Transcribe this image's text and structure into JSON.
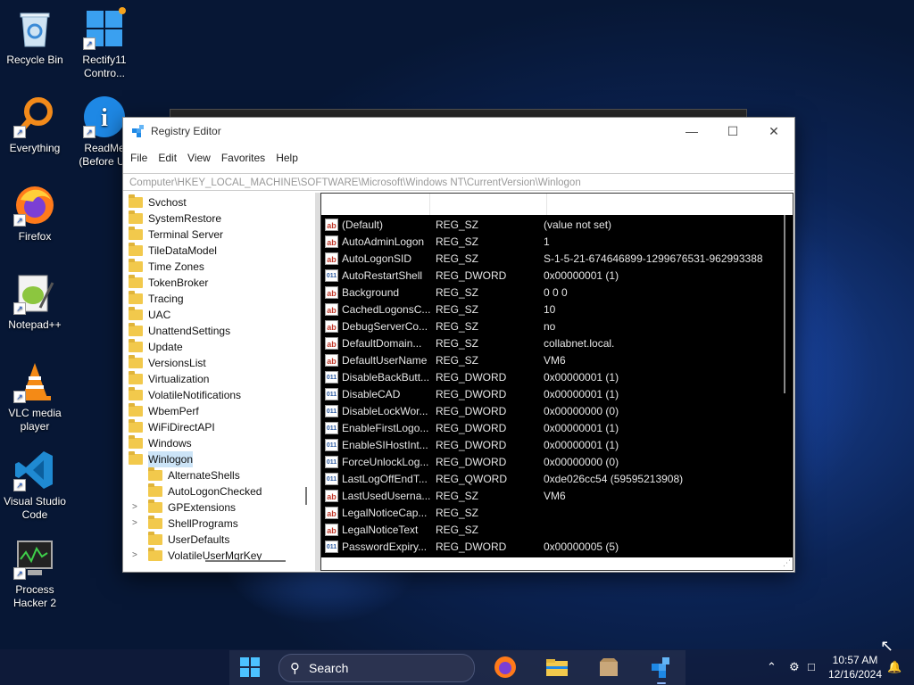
{
  "desktop": {
    "icons": [
      {
        "label": "Recycle Bin"
      },
      {
        "label": "Rectify11 Contro..."
      },
      {
        "label": "Everything"
      },
      {
        "label": "ReadMe (Before Us"
      },
      {
        "label": "Firefox"
      },
      {
        "label": "Notepad++"
      },
      {
        "label": "VLC media player"
      },
      {
        "label": "Visual Studio Code"
      },
      {
        "label": "Process Hacker 2"
      }
    ]
  },
  "window": {
    "title": "Registry Editor",
    "minimize": "—",
    "maximize": "☐",
    "close": "✕",
    "menu": [
      "File",
      "Edit",
      "View",
      "Favorites",
      "Help"
    ],
    "address": "Computer\\HKEY_LOCAL_MACHINE\\SOFTWARE\\Microsoft\\Windows NT\\CurrentVersion\\Winlogon"
  },
  "tree": {
    "items": [
      {
        "label": "Svchost"
      },
      {
        "label": "SystemRestore"
      },
      {
        "label": "Terminal Server"
      },
      {
        "label": "TileDataModel"
      },
      {
        "label": "Time Zones"
      },
      {
        "label": "TokenBroker"
      },
      {
        "label": "Tracing"
      },
      {
        "label": "UAC"
      },
      {
        "label": "UnattendSettings"
      },
      {
        "label": "Update"
      },
      {
        "label": "VersionsList"
      },
      {
        "label": "Virtualization"
      },
      {
        "label": "VolatileNotifications"
      },
      {
        "label": "WbemPerf"
      },
      {
        "label": "WiFiDirectAPI"
      },
      {
        "label": "Windows"
      },
      {
        "label": "Winlogon",
        "selected": true
      }
    ],
    "children": [
      {
        "label": "AlternateShells",
        "expander": ""
      },
      {
        "label": "AutoLogonChecked",
        "expander": ""
      },
      {
        "label": "GPExtensions",
        "expander": ">"
      },
      {
        "label": "ShellPrograms",
        "expander": ">"
      },
      {
        "label": "UserDefaults",
        "expander": ""
      },
      {
        "label": "VolatileUserMgrKey",
        "expander": ">"
      }
    ]
  },
  "values": {
    "rows": [
      {
        "name": "(Default)",
        "type": "REG_SZ",
        "data": "(value not set)",
        "icon": "ab"
      },
      {
        "name": "AutoAdminLogon",
        "type": "REG_SZ",
        "data": "1",
        "icon": "ab"
      },
      {
        "name": "AutoLogonSID",
        "type": "REG_SZ",
        "data": "S-1-5-21-674646899-1299676531-962993388",
        "icon": "ab"
      },
      {
        "name": "AutoRestartShell",
        "type": "REG_DWORD",
        "data": "0x00000001 (1)",
        "icon": "dw"
      },
      {
        "name": "Background",
        "type": "REG_SZ",
        "data": "0 0 0",
        "icon": "ab"
      },
      {
        "name": "CachedLogonsC...",
        "type": "REG_SZ",
        "data": "10",
        "icon": "ab"
      },
      {
        "name": "DebugServerCo...",
        "type": "REG_SZ",
        "data": "no",
        "icon": "ab"
      },
      {
        "name": "DefaultDomain...",
        "type": "REG_SZ",
        "data": "collabnet.local.",
        "icon": "ab"
      },
      {
        "name": "DefaultUserName",
        "type": "REG_SZ",
        "data": "VM6",
        "icon": "ab"
      },
      {
        "name": "DisableBackButt...",
        "type": "REG_DWORD",
        "data": "0x00000001 (1)",
        "icon": "dw"
      },
      {
        "name": "DisableCAD",
        "type": "REG_DWORD",
        "data": "0x00000001 (1)",
        "icon": "dw"
      },
      {
        "name": "DisableLockWor...",
        "type": "REG_DWORD",
        "data": "0x00000000 (0)",
        "icon": "dw"
      },
      {
        "name": "EnableFirstLogo...",
        "type": "REG_DWORD",
        "data": "0x00000001 (1)",
        "icon": "dw"
      },
      {
        "name": "EnableSIHostInt...",
        "type": "REG_DWORD",
        "data": "0x00000001 (1)",
        "icon": "dw"
      },
      {
        "name": "ForceUnlockLog...",
        "type": "REG_DWORD",
        "data": "0x00000000 (0)",
        "icon": "dw"
      },
      {
        "name": "LastLogOffEndT...",
        "type": "REG_QWORD",
        "data": "0xde026cc54 (59595213908)",
        "icon": "dw"
      },
      {
        "name": "LastUsedUserna...",
        "type": "REG_SZ",
        "data": "VM6",
        "icon": "ab"
      },
      {
        "name": "LegalNoticeCap...",
        "type": "REG_SZ",
        "data": "",
        "icon": "ab"
      },
      {
        "name": "LegalNoticeText",
        "type": "REG_SZ",
        "data": "",
        "icon": "ab"
      },
      {
        "name": "PasswordExpiry...",
        "type": "REG_DWORD",
        "data": "0x00000005 (5)",
        "icon": "dw"
      }
    ]
  },
  "taskbar": {
    "search_label": "Search",
    "time": "10:57 AM",
    "date": "12/16/2024"
  },
  "colors": {
    "accent": "#0078d4",
    "selection": "#cce4f7",
    "values_background": "#000000"
  }
}
